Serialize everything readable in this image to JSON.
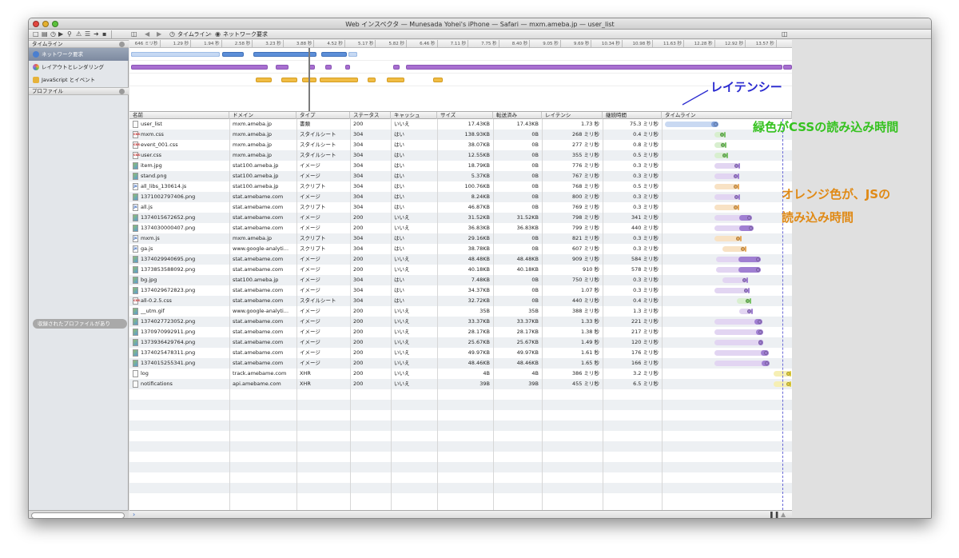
{
  "window": {
    "title": "Web インスペクタ — Munesada Yohei's iPhone — Safari — mxm.ameba.jp — user_list"
  },
  "toolbar": {
    "breadcrumb": [
      "タイムライン",
      "ネットワーク要求"
    ]
  },
  "sidebar": {
    "timeline_header": "タイムライン",
    "items": [
      {
        "label": "ネットワーク要求",
        "color": "#4a7fd0"
      },
      {
        "label": "レイアウトとレンダリング",
        "color": "#a86fd0"
      },
      {
        "label": "JavaScript とイベント",
        "color": "#e6b23a"
      }
    ],
    "profile_header": "プロファイル",
    "profile_empty": "収録されたプロファイルがあり"
  },
  "ruler": {
    "ticks": [
      "646 ミリ秒",
      "1.29 秒",
      "1.94 秒",
      "2.58 秒",
      "3.23 秒",
      "3.88 秒",
      "4.52 秒",
      "5.17 秒",
      "5.82 秒",
      "6.46 秒",
      "7.11 秒",
      "7.75 秒",
      "8.40 秒",
      "9.05 秒",
      "9.69 秒",
      "10.34 秒",
      "10.98 秒",
      "11.63 秒",
      "12.28 秒",
      "12.92 秒",
      "13.57 秒"
    ]
  },
  "overview": {
    "network_bars": [
      [
        2,
        113
      ],
      [
        116,
        143
      ],
      [
        155,
        234
      ],
      [
        240,
        272
      ],
      [
        274,
        285
      ]
    ],
    "layout_bars": [
      [
        2,
        173
      ],
      [
        183,
        199
      ],
      [
        225,
        232
      ],
      [
        245,
        253
      ],
      [
        270,
        276
      ],
      [
        330,
        338
      ],
      [
        346,
        817
      ],
      [
        818,
        829
      ]
    ],
    "js_bars": [
      [
        158,
        178
      ],
      [
        190,
        210
      ],
      [
        216,
        234
      ],
      [
        238,
        286
      ],
      [
        298,
        308
      ],
      [
        322,
        344
      ],
      [
        380,
        392
      ]
    ]
  },
  "columns": [
    "名前",
    "ドメイン",
    "タイプ",
    "ステータス",
    "キャッシュ",
    "サイズ",
    "転送済み",
    "レイテンシ",
    "継続時間",
    "タイムライン"
  ],
  "rows": [
    {
      "icon": "doc",
      "name": "user_list",
      "domain": "mxm.ameba.jp",
      "type": "書類",
      "status": "200",
      "cache": "いいえ",
      "size": "17.43KB",
      "transferred": "17.43KB",
      "latency": "1.73 秒",
      "duration": "75.3 ミリ秒",
      "tl": [
        4,
        62,
        71
      ],
      "kind": "doc"
    },
    {
      "icon": "css",
      "name": "mxm.css",
      "domain": "mxm.ameba.jp",
      "type": "スタイルシート",
      "status": "304",
      "cache": "はい",
      "size": "138.93KB",
      "transferred": "0B",
      "latency": "268 ミリ秒",
      "duration": "0.4 ミリ秒",
      "tl": [
        66,
        78,
        79
      ],
      "kind": "css"
    },
    {
      "icon": "css",
      "name": "event_001.css",
      "domain": "mxm.ameba.jp",
      "type": "スタイルシート",
      "status": "304",
      "cache": "はい",
      "size": "38.07KB",
      "transferred": "0B",
      "latency": "277 ミリ秒",
      "duration": "0.8 ミリ秒",
      "tl": [
        66,
        79,
        80
      ],
      "kind": "css"
    },
    {
      "icon": "css",
      "name": "user.css",
      "domain": "mxm.ameba.jp",
      "type": "スタイルシート",
      "status": "304",
      "cache": "はい",
      "size": "12.55KB",
      "transferred": "0B",
      "latency": "355 ミリ秒",
      "duration": "0.5 ミリ秒",
      "tl": [
        66,
        81,
        82
      ],
      "kind": "css"
    },
    {
      "icon": "img",
      "name": "item.jpg",
      "domain": "stat100.ameba.jp",
      "type": "イメージ",
      "status": "304",
      "cache": "はい",
      "size": "18.79KB",
      "transferred": "0B",
      "latency": "776 ミリ秒",
      "duration": "0.3 ミリ秒",
      "tl": [
        66,
        96,
        97
      ],
      "kind": "img"
    },
    {
      "icon": "img",
      "name": "stand.png",
      "domain": "stat100.ameba.jp",
      "type": "イメージ",
      "status": "304",
      "cache": "はい",
      "size": "5.37KB",
      "transferred": "0B",
      "latency": "767 ミリ秒",
      "duration": "0.3 ミリ秒",
      "tl": [
        66,
        95,
        96
      ],
      "kind": "img"
    },
    {
      "icon": "js",
      "name": "all_libs_130614.js",
      "domain": "stat100.ameba.jp",
      "type": "スクリプト",
      "status": "304",
      "cache": "はい",
      "size": "100.76KB",
      "transferred": "0B",
      "latency": "768 ミリ秒",
      "duration": "0.5 ミリ秒",
      "tl": [
        66,
        95,
        96
      ],
      "kind": "js"
    },
    {
      "icon": "img",
      "name": "1371002797406.png",
      "domain": "stat.amebame.com",
      "type": "イメージ",
      "status": "304",
      "cache": "はい",
      "size": "8.24KB",
      "transferred": "0B",
      "latency": "800 ミリ秒",
      "duration": "0.3 ミリ秒",
      "tl": [
        66,
        96,
        97
      ],
      "kind": "img"
    },
    {
      "icon": "js",
      "name": "all.js",
      "domain": "stat.amebame.com",
      "type": "スクリプト",
      "status": "304",
      "cache": "はい",
      "size": "46.87KB",
      "transferred": "0B",
      "latency": "769 ミリ秒",
      "duration": "0.3 ミリ秒",
      "tl": [
        66,
        95,
        96
      ],
      "kind": "js"
    },
    {
      "icon": "img",
      "name": "1374015672652.png",
      "domain": "stat.amebame.com",
      "type": "イメージ",
      "status": "200",
      "cache": "いいえ",
      "size": "31.52KB",
      "transferred": "31.52KB",
      "latency": "798 ミリ秒",
      "duration": "341 ミリ秒",
      "tl": [
        66,
        97,
        113
      ],
      "kind": "img"
    },
    {
      "icon": "img",
      "name": "1374030000407.png",
      "domain": "stat.amebame.com",
      "type": "イメージ",
      "status": "200",
      "cache": "いいえ",
      "size": "36.83KB",
      "transferred": "36.83KB",
      "latency": "799 ミリ秒",
      "duration": "440 ミリ秒",
      "tl": [
        66,
        97,
        115
      ],
      "kind": "img"
    },
    {
      "icon": "js",
      "name": "mxm.js",
      "domain": "mxm.ameba.jp",
      "type": "スクリプト",
      "status": "304",
      "cache": "はい",
      "size": "29.16KB",
      "transferred": "0B",
      "latency": "821 ミリ秒",
      "duration": "0.3 ミリ秒",
      "tl": [
        66,
        98,
        99
      ],
      "kind": "js"
    },
    {
      "icon": "js",
      "name": "ga.js",
      "domain": "www.google-analyti...",
      "type": "スクリプト",
      "status": "304",
      "cache": "はい",
      "size": "38.78KB",
      "transferred": "0B",
      "latency": "607 ミリ秒",
      "duration": "0.3 ミリ秒",
      "tl": [
        76,
        104,
        105
      ],
      "kind": "js"
    },
    {
      "icon": "img",
      "name": "1374029940695.png",
      "domain": "stat.amebame.com",
      "type": "イメージ",
      "status": "200",
      "cache": "いいえ",
      "size": "48.48KB",
      "transferred": "48.48KB",
      "latency": "909 ミリ秒",
      "duration": "584 ミリ秒",
      "tl": [
        68,
        96,
        124
      ],
      "kind": "img"
    },
    {
      "icon": "img",
      "name": "1373853588092.png",
      "domain": "stat.amebame.com",
      "type": "イメージ",
      "status": "200",
      "cache": "いいえ",
      "size": "40.18KB",
      "transferred": "40.18KB",
      "latency": "910 秒",
      "duration": "578 ミリ秒",
      "tl": [
        68,
        96,
        124
      ],
      "kind": "img"
    },
    {
      "icon": "img",
      "name": "bg.jpg",
      "domain": "stat100.ameba.jp",
      "type": "イメージ",
      "status": "304",
      "cache": "はい",
      "size": "7.48KB",
      "transferred": "0B",
      "latency": "750 ミリ秒",
      "duration": "0.3 ミリ秒",
      "tl": [
        76,
        106,
        107
      ],
      "kind": "img"
    },
    {
      "icon": "img",
      "name": "1374029672823.png",
      "domain": "stat.amebame.com",
      "type": "イメージ",
      "status": "304",
      "cache": "はい",
      "size": "34.37KB",
      "transferred": "0B",
      "latency": "1.07 秒",
      "duration": "0.3 ミリ秒",
      "tl": [
        66,
        108,
        109
      ],
      "kind": "img"
    },
    {
      "icon": "css",
      "name": "all-0.2.5.css",
      "domain": "stat.amebame.com",
      "type": "スタイルシート",
      "status": "304",
      "cache": "はい",
      "size": "32.72KB",
      "transferred": "0B",
      "latency": "440 ミリ秒",
      "duration": "0.4 ミリ秒",
      "tl": [
        94,
        110,
        111
      ],
      "kind": "css"
    },
    {
      "icon": "img",
      "name": "__utm.gif",
      "domain": "www.google-analyti...",
      "type": "イメージ",
      "status": "200",
      "cache": "いいえ",
      "size": "35B",
      "transferred": "35B",
      "latency": "388 ミリ秒",
      "duration": "1.3 ミリ秒",
      "tl": [
        97,
        112,
        113
      ],
      "kind": "img"
    },
    {
      "icon": "img",
      "name": "1374027723052.png",
      "domain": "stat.amebame.com",
      "type": "イメージ",
      "status": "200",
      "cache": "いいえ",
      "size": "33.37KB",
      "transferred": "33.37KB",
      "latency": "1.33 秒",
      "duration": "221 ミリ秒",
      "tl": [
        66,
        116,
        126
      ],
      "kind": "img"
    },
    {
      "icon": "img",
      "name": "1370970992911.png",
      "domain": "stat.amebame.com",
      "type": "イメージ",
      "status": "200",
      "cache": "いいえ",
      "size": "28.17KB",
      "transferred": "28.17KB",
      "latency": "1.38 秒",
      "duration": "217 ミリ秒",
      "tl": [
        66,
        118,
        127
      ],
      "kind": "img"
    },
    {
      "icon": "img",
      "name": "1373936429764.png",
      "domain": "stat.amebame.com",
      "type": "イメージ",
      "status": "200",
      "cache": "いいえ",
      "size": "25.67KB",
      "transferred": "25.67KB",
      "latency": "1.49 秒",
      "duration": "120 ミリ秒",
      "tl": [
        66,
        121,
        127
      ],
      "kind": "img"
    },
    {
      "icon": "img",
      "name": "1374025478311.png",
      "domain": "stat.amebame.com",
      "type": "イメージ",
      "status": "200",
      "cache": "いいえ",
      "size": "49.97KB",
      "transferred": "49.97KB",
      "latency": "1.61 秒",
      "duration": "176 ミリ秒",
      "tl": [
        66,
        124,
        134
      ],
      "kind": "img"
    },
    {
      "icon": "img",
      "name": "1374015255341.png",
      "domain": "stat.amebame.com",
      "type": "イメージ",
      "status": "200",
      "cache": "いいえ",
      "size": "48.46KB",
      "transferred": "48.46KB",
      "latency": "1.65 秒",
      "duration": "166 ミリ秒",
      "tl": [
        66,
        125,
        135
      ],
      "kind": "img"
    },
    {
      "icon": "doc",
      "name": "log",
      "domain": "track.amebame.com",
      "type": "XHR",
      "status": "200",
      "cache": "いいえ",
      "size": "4B",
      "transferred": "4B",
      "latency": "386 ミリ秒",
      "duration": "3.2 ミリ秒",
      "tl": [
        140,
        160,
        162
      ],
      "kind": "xhr"
    },
    {
      "icon": "doc",
      "name": "notifications",
      "domain": "api.amebame.com",
      "type": "XHR",
      "status": "200",
      "cache": "いいえ",
      "size": "39B",
      "transferred": "39B",
      "latency": "455 ミリ秒",
      "duration": "6.5 ミリ秒",
      "tl": [
        140,
        160,
        162
      ],
      "kind": "xhr"
    }
  ],
  "colors": {
    "doc": [
      "#c9d9f2",
      "#7f9fd8"
    ],
    "css": [
      "#d8efcf",
      "#79c266"
    ],
    "img": [
      "#e2d5f2",
      "#a07fd2"
    ],
    "js": [
      "#f8e2c4",
      "#e6a85a"
    ],
    "xhr": [
      "#f6efb4",
      "#e2cf3f"
    ]
  },
  "annotations": {
    "latency": "レイテンシー",
    "css": "緑色がCSSの読み込み時間",
    "js_line1": "オレンジ色が、JSの",
    "js_line2": "読み込み時間"
  }
}
